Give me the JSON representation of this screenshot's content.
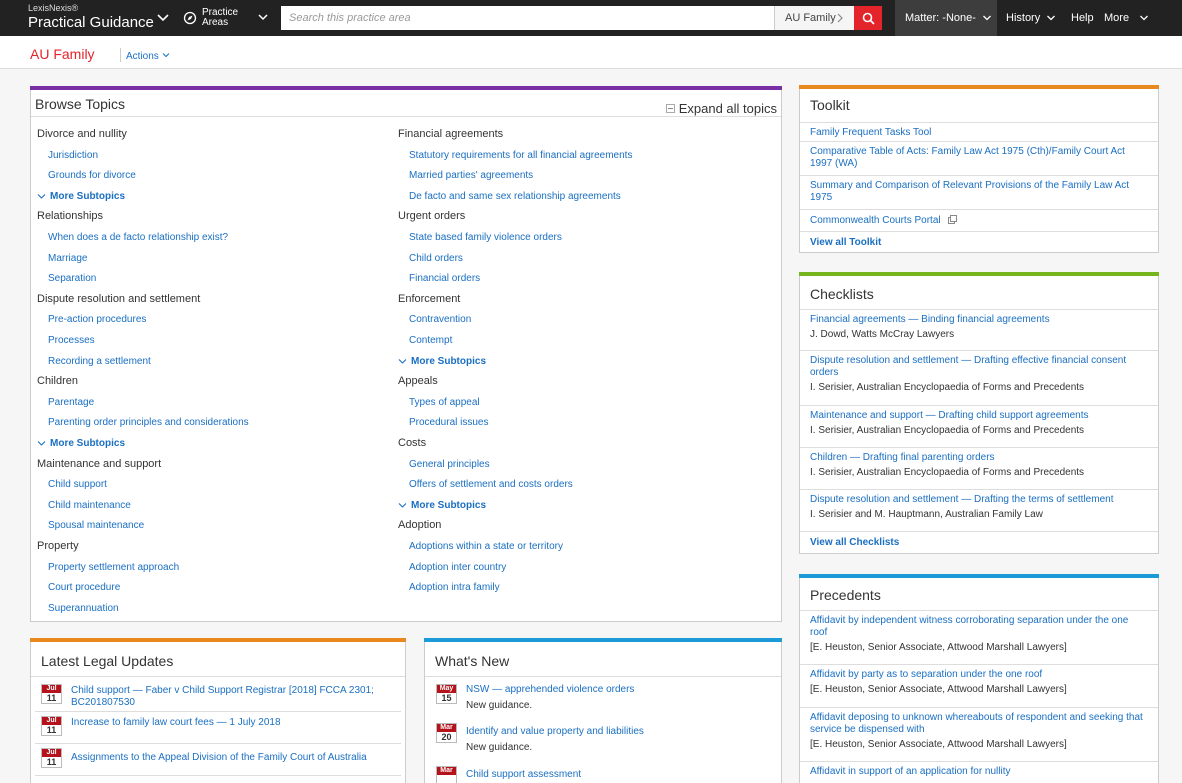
{
  "header": {
    "brand_small": "LexisNexis®",
    "brand_name": "Practical Guidance",
    "practice_areas": [
      "Practice",
      "Areas"
    ],
    "search_placeholder": "Search this practice area",
    "search_scope": "AU Family",
    "matter": "Matter: -None-",
    "history": "History",
    "help": "Help",
    "more": "More"
  },
  "subheader": {
    "title": "AU Family",
    "actions": "Actions"
  },
  "browse": {
    "title": "Browse Topics",
    "expand_all": "Expand all topics",
    "more_label": "More Subtopics",
    "left": [
      {
        "category": "Divorce and nullity",
        "subs": [
          "Jurisdiction",
          "Grounds for divorce"
        ],
        "more": true
      },
      {
        "category": "Relationships",
        "subs": [
          "When does a de facto relationship exist?",
          "Marriage",
          "Separation"
        ],
        "more": false
      },
      {
        "category": "Dispute resolution and settlement",
        "subs": [
          "Pre-action procedures",
          "Processes",
          "Recording a settlement"
        ],
        "more": false
      },
      {
        "category": "Children",
        "subs": [
          "Parentage",
          "Parenting order principles and considerations"
        ],
        "more": true
      },
      {
        "category": "Maintenance and support",
        "subs": [
          "Child support",
          "Child maintenance",
          "Spousal maintenance"
        ],
        "more": false
      },
      {
        "category": "Property",
        "subs": [
          "Property settlement approach",
          "Court procedure",
          "Superannuation"
        ],
        "more": false
      }
    ],
    "right": [
      {
        "category": "Financial agreements",
        "subs": [
          "Statutory requirements for all financial agreements",
          "Married parties' agreements",
          "De facto and same sex relationship agreements"
        ],
        "more": false
      },
      {
        "category": "Urgent orders",
        "subs": [
          "State based family violence orders",
          "Child orders",
          "Financial orders"
        ],
        "more": false
      },
      {
        "category": "Enforcement",
        "subs": [
          "Contravention",
          "Contempt"
        ],
        "more": true
      },
      {
        "category": "Appeals",
        "subs": [
          "Types of appeal",
          "Procedural issues"
        ],
        "more": false
      },
      {
        "category": "Costs",
        "subs": [
          "General principles",
          "Offers of settlement and costs orders"
        ],
        "more": true
      },
      {
        "category": "Adoption",
        "subs": [
          "Adoptions within a state or territory",
          "Adoption inter country",
          "Adoption intra family"
        ],
        "more": false
      }
    ]
  },
  "toolkit": {
    "title": "Toolkit",
    "items": [
      "Family Frequent Tasks Tool",
      "Comparative Table of Acts: Family Law Act 1975 (Cth)/Family Court Act 1997 (WA)",
      "Summary and Comparison of Relevant Provisions of the Family Law Act 1975",
      "Commonwealth Courts Portal"
    ],
    "view_all": "View all Toolkit"
  },
  "checklists": {
    "title": "Checklists",
    "items": [
      {
        "link": "Financial agreements — Binding financial agreements",
        "meta": "J. Dowd, Watts McCray Lawyers"
      },
      {
        "link": "Dispute resolution and settlement — Drafting effective financial consent orders",
        "meta": "I. Serisier, Australian Encyclopaedia of Forms and Precedents"
      },
      {
        "link": "Maintenance and support — Drafting child support agreements",
        "meta": "I. Serisier, Australian Encyclopaedia of Forms and Precedents"
      },
      {
        "link": "Children — Drafting final parenting orders",
        "meta": "I. Serisier, Australian Encyclopaedia of Forms and Precedents"
      },
      {
        "link": "Dispute resolution and settlement — Drafting the terms of settlement",
        "meta": "I. Serisier and M. Hauptmann, Australian Family Law"
      }
    ],
    "view_all": "View all Checklists"
  },
  "precedents": {
    "title": "Precedents",
    "items": [
      {
        "link": "Affidavit by independent witness corroborating separation under the one roof",
        "meta": "[E. Heuston, Senior Associate, Attwood Marshall Lawyers]"
      },
      {
        "link": "Affidavit by party as to separation under the one roof",
        "meta": "[E. Heuston, Senior Associate, Attwood Marshall Lawyers]"
      },
      {
        "link": "Affidavit deposing to unknown whereabouts of respondent and seeking that service be dispensed with",
        "meta": "[E. Heuston, Senior Associate, Attwood Marshall Lawyers]"
      },
      {
        "link": "Affidavit in support of an application for nullity",
        "meta": ""
      }
    ]
  },
  "legal_updates": {
    "title": "Latest Legal Updates",
    "items": [
      {
        "month": "Jul",
        "day": "11",
        "text": "Child support — Faber v Child Support Registrar [2018] FCCA 2301; BC201807530"
      },
      {
        "month": "Jul",
        "day": "11",
        "text": "Increase to family law court fees — 1 July 2018"
      },
      {
        "month": "Jul",
        "day": "11",
        "text": "Assignments to the Appeal Division of the Family Court of Australia"
      }
    ]
  },
  "whats_new": {
    "title": "What's New",
    "items": [
      {
        "month": "May",
        "day": "15",
        "text": "NSW — apprehended violence orders",
        "meta": "New guidance."
      },
      {
        "month": "Mar",
        "day": "20",
        "text": "Identify and value property and liabilities",
        "meta": "New guidance."
      },
      {
        "month": "Mar",
        "day": "",
        "text": "Child support assessment",
        "meta": ""
      }
    ]
  },
  "colors": {
    "purple": "#7b2fa5",
    "orange": "#e8891e",
    "green": "#77b51c",
    "blue": "#1a9bd7",
    "red": "#e3242b"
  }
}
